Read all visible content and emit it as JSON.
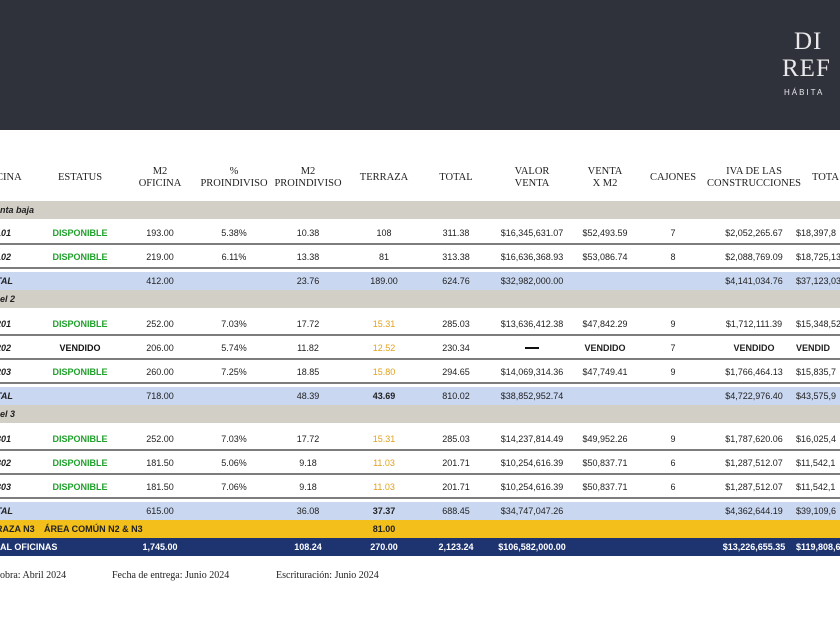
{
  "brand": {
    "line1": "DI",
    "line2": "REF",
    "line3": "HÁBITA"
  },
  "headers": [
    "CINA",
    "ESTATUS",
    "M2\nOFICINA",
    "%\nPROINDIVISO",
    "M2\nPROINDIVISO",
    "TERRAZA",
    "TOTAL",
    "VALOR\nVENTA",
    "VENTA\nX M2",
    "CAJONES",
    "IVA DE LAS\nCONSTRUCCIONES",
    "TOTA"
  ],
  "rows": [
    {
      "kind": "section",
      "label": "nta baja"
    },
    {
      "kind": "unit",
      "id": "101",
      "status": "DISPONIBLE",
      "m2_oficina": "193.00",
      "proindiviso_pct": "5.38%",
      "m2_proindiviso": "10.38",
      "terraza": "108",
      "total": "311.38",
      "valor_venta": "$16,345,631.07",
      "venta_m2": "$52,493.59",
      "cajones": "7",
      "iva": "$2,052,265.67",
      "total_final": "$18,397,8"
    },
    {
      "kind": "unit",
      "id": "102",
      "status": "DISPONIBLE",
      "m2_oficina": "219.00",
      "proindiviso_pct": "6.11%",
      "m2_proindiviso": "13.38",
      "terraza": "81",
      "total": "313.38",
      "valor_venta": "$16,636,368.93",
      "venta_m2": "$53,086.74",
      "cajones": "8",
      "iva": "$2,088,769.09",
      "total_final": "$18,725,13"
    },
    {
      "kind": "total",
      "id": "TAL",
      "status": "",
      "m2_oficina": "412.00",
      "proindiviso_pct": "",
      "m2_proindiviso": "23.76",
      "terraza": "189.00",
      "total": "624.76",
      "valor_venta": "$32,982,000.00",
      "venta_m2": "",
      "cajones": "",
      "iva": "$4,141,034.76",
      "total_final": "$37,123,03"
    },
    {
      "kind": "section",
      "label": "el 2"
    },
    {
      "kind": "unit",
      "id": "201",
      "status": "DISPONIBLE",
      "m2_oficina": "252.00",
      "proindiviso_pct": "7.03%",
      "m2_proindiviso": "17.72",
      "terraza": "15.31",
      "terraza_hl": true,
      "total": "285.03",
      "valor_venta": "$13,636,412.38",
      "venta_m2": "$47,842.29",
      "cajones": "9",
      "iva": "$1,712,111.39",
      "total_final": "$15,348,52"
    },
    {
      "kind": "unit",
      "id": "202",
      "status": "VENDIDO",
      "m2_oficina": "206.00",
      "proindiviso_pct": "5.74%",
      "m2_proindiviso": "11.82",
      "terraza": "12.52",
      "terraza_hl": true,
      "total": "230.34",
      "valor_venta": "",
      "valor_dash": true,
      "venta_m2": "VENDIDO",
      "cajones": "7",
      "iva": "VENDIDO",
      "total_final": "VENDID"
    },
    {
      "kind": "unit",
      "id": "203",
      "status": "DISPONIBLE",
      "m2_oficina": "260.00",
      "proindiviso_pct": "7.25%",
      "m2_proindiviso": "18.85",
      "terraza": "15.80",
      "terraza_hl": true,
      "total": "294.65",
      "valor_venta": "$14,069,314.36",
      "venta_m2": "$47,749.41",
      "cajones": "9",
      "iva": "$1,766,464.13",
      "total_final": "$15,835,7"
    },
    {
      "kind": "total",
      "id": "TAL",
      "status": "",
      "m2_oficina": "718.00",
      "proindiviso_pct": "",
      "m2_proindiviso": "48.39",
      "terraza": "43.69",
      "terraza_bold": true,
      "total": "810.02",
      "valor_venta": "$38,852,952.74",
      "venta_m2": "",
      "cajones": "",
      "iva": "$4,722,976.40",
      "total_final": "$43,575,9"
    },
    {
      "kind": "section",
      "label": "el 3"
    },
    {
      "kind": "unit",
      "id": "301",
      "status": "DISPONIBLE",
      "m2_oficina": "252.00",
      "proindiviso_pct": "7.03%",
      "m2_proindiviso": "17.72",
      "terraza": "15.31",
      "terraza_hl": true,
      "total": "285.03",
      "valor_venta": "$14,237,814.49",
      "venta_m2": "$49,952.26",
      "cajones": "9",
      "iva": "$1,787,620.06",
      "total_final": "$16,025,4"
    },
    {
      "kind": "unit",
      "id": "302",
      "status": "DISPONIBLE",
      "m2_oficina": "181.50",
      "proindiviso_pct": "5.06%",
      "m2_proindiviso": "9.18",
      "terraza": "11.03",
      "terraza_hl": true,
      "total": "201.71",
      "valor_venta": "$10,254,616.39",
      "venta_m2": "$50,837.71",
      "cajones": "6",
      "iva": "$1,287,512.07",
      "total_final": "$11,542,1"
    },
    {
      "kind": "unit",
      "id": "303",
      "status": "DISPONIBLE",
      "m2_oficina": "181.50",
      "proindiviso_pct": "7.06%",
      "m2_proindiviso": "9.18",
      "terraza": "11.03",
      "terraza_hl": true,
      "total": "201.71",
      "valor_venta": "$10,254,616.39",
      "venta_m2": "$50,837.71",
      "cajones": "6",
      "iva": "$1,287,512.07",
      "total_final": "$11,542,1"
    },
    {
      "kind": "total",
      "id": "TAL",
      "status": "",
      "m2_oficina": "615.00",
      "proindiviso_pct": "",
      "m2_proindiviso": "36.08",
      "terraza": "37.37",
      "terraza_bold": true,
      "total": "688.45",
      "valor_venta": "$34,747,047.26",
      "venta_m2": "",
      "cajones": "",
      "iva": "$4,362,644.19",
      "total_final": "$39,109,6"
    },
    {
      "kind": "terraza",
      "id": "RAZA N3",
      "label": "ÁREA COMÚN N2 & N3",
      "terraza": "81.00"
    },
    {
      "kind": "grand",
      "label": "AL OFICINAS",
      "m2_oficina": "1,745.00",
      "m2_proindiviso": "108.24",
      "terraza": "270.00",
      "total": "2,123.24",
      "valor_venta": "$106,582,000.00",
      "iva": "$13,226,655.35",
      "total_final": "$119,808,6"
    }
  ],
  "footer": {
    "obra": "obra: Abril 2024",
    "entrega": "Fecha de entrega: Junio 2024",
    "escrituracion": "Escrituración: Junio 2024"
  }
}
